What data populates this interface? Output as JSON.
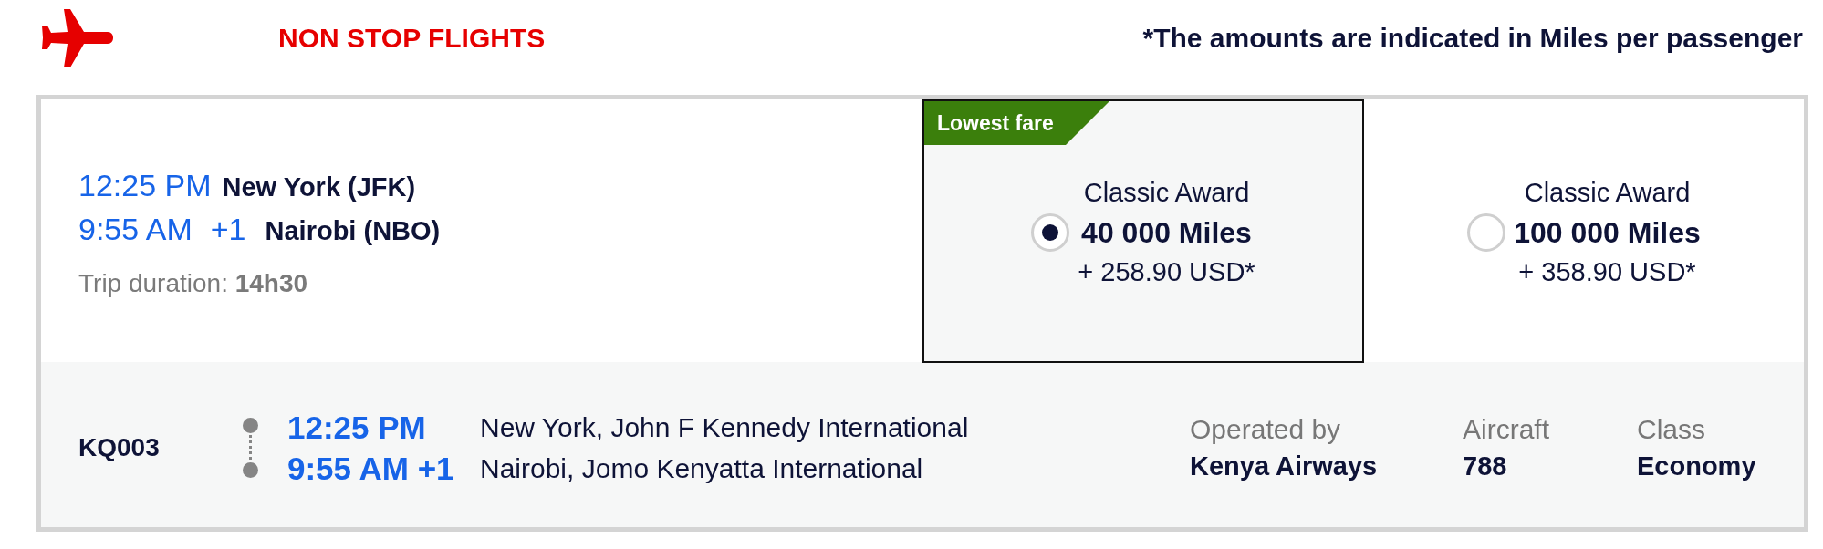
{
  "header": {
    "title": "NON STOP FLIGHTS",
    "note": "*The amounts are indicated in Miles per passenger"
  },
  "itinerary": {
    "departure": {
      "time": "12:25 PM",
      "city": "New York (JFK)"
    },
    "arrival": {
      "time": "9:55 AM",
      "day_offset": "+1",
      "city": "Nairobi (NBO)"
    },
    "duration": "Trip duration: **14h30**"
  },
  "fares": [
    {
      "badge": "Lowest fare",
      "name": "Classic Award",
      "miles": "40 000 Miles",
      "price": "+ 258.90 USD*",
      "selected": true
    },
    {
      "name": "Classic Award",
      "miles": "100 000 Miles",
      "price": "+ 358.90 USD*",
      "selected": false
    }
  ],
  "segment": {
    "flight_number": "KQ003",
    "departure": {
      "time": "12:25 PM",
      "airport": "New York, John F Kennedy International"
    },
    "arrival": {
      "time": "9:55 AM +1",
      "airport": "Nairobi, Jomo Kenyatta International"
    },
    "details": [
      {
        "label": "Operated by",
        "value": "Kenya Airways"
      },
      {
        "label": "Aircraft",
        "value": "788"
      },
      {
        "label": "Class",
        "value": "Economy"
      }
    ]
  }
}
